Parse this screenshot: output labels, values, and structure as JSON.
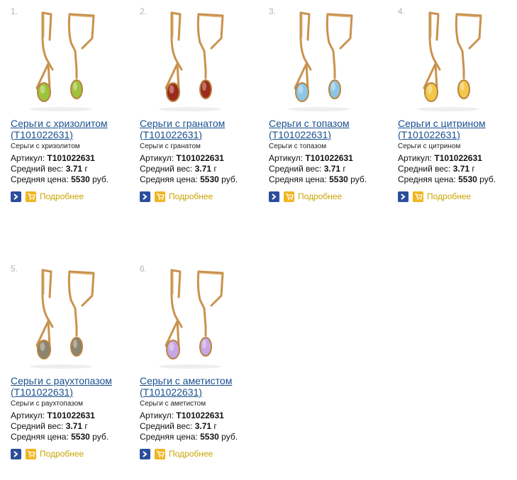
{
  "products": [
    {
      "number": "1.",
      "title_line1": "Серьги с хризолитом",
      "title_line2": "(Т101022631)",
      "subtitle": "Серьги с хризолитом",
      "article_label": "Артикул:",
      "article": "Т101022631",
      "weight_label": "Средний вес:",
      "weight": "3.71",
      "weight_unit": "г",
      "price_label": "Средняя цена:",
      "price": "5530",
      "price_unit": "руб.",
      "more_label": "Подробнее",
      "stone_color": "#9dc23b",
      "stone_dark": "#5d8a1a"
    },
    {
      "number": "2.",
      "title_line1": "Серьги с гранатом",
      "title_line2": "(Т101022631)",
      "subtitle": "Серьги с гранатом",
      "article_label": "Артикул:",
      "article": "Т101022631",
      "weight_label": "Средний вес:",
      "weight": "3.71",
      "weight_unit": "г",
      "price_label": "Средняя цена:",
      "price": "5530",
      "price_unit": "руб.",
      "more_label": "Подробнее",
      "stone_color": "#9c2a1c",
      "stone_dark": "#5a0e08"
    },
    {
      "number": "3.",
      "title_line1": "Серьги с топазом",
      "title_line2": "(Т101022631)",
      "subtitle": "Серьги с топазом",
      "article_label": "Артикул:",
      "article": "Т101022631",
      "weight_label": "Средний вес:",
      "weight": "3.71",
      "weight_unit": "г",
      "price_label": "Средняя цена:",
      "price": "5530",
      "price_unit": "руб.",
      "more_label": "Подробнее",
      "stone_color": "#8cc6e6",
      "stone_dark": "#3f86b5"
    },
    {
      "number": "4.",
      "title_line1": "Серьги с цитрином",
      "title_line2": "(Т101022631)",
      "subtitle": "Серьги с цитрином",
      "article_label": "Артикул:",
      "article": "Т101022631",
      "weight_label": "Средний вес:",
      "weight": "3.71",
      "weight_unit": "г",
      "price_label": "Средняя цена:",
      "price": "5530",
      "price_unit": "руб.",
      "more_label": "Подробнее",
      "stone_color": "#f2c74a",
      "stone_dark": "#c58a14"
    },
    {
      "number": "5.",
      "title_line1": "Серьги с раухтопазом",
      "title_line2": "(Т101022631)",
      "subtitle": "Серьги с раухтопазом",
      "article_label": "Артикул:",
      "article": "Т101022631",
      "weight_label": "Средний вес:",
      "weight": "3.71",
      "weight_unit": "г",
      "price_label": "Средняя цена:",
      "price": "5530",
      "price_unit": "руб.",
      "more_label": "Подробнее",
      "stone_color": "#8c8370",
      "stone_dark": "#4a4232"
    },
    {
      "number": "6.",
      "title_line1": "Серьги с аметистом",
      "title_line2": "(Т101022631)",
      "subtitle": "Серьги с аметистом",
      "article_label": "Артикул:",
      "article": "Т101022631",
      "weight_label": "Средний вес:",
      "weight": "3.71",
      "weight_unit": "г",
      "price_label": "Средняя цена:",
      "price": "5530",
      "price_unit": "руб.",
      "more_label": "Подробнее",
      "stone_color": "#c7a6e6",
      "stone_dark": "#8a62b8"
    }
  ]
}
